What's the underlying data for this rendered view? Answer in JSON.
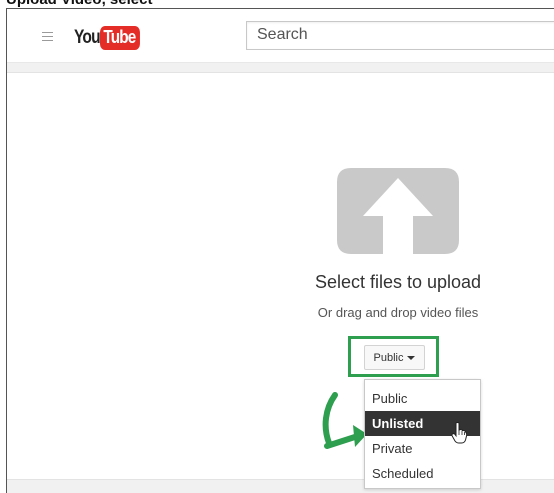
{
  "caption_fragment": "Upload Video, select",
  "header": {
    "logo_you": "You",
    "logo_tube": "Tube",
    "search_placeholder": "Search",
    "icons": [
      "menu-icon"
    ]
  },
  "upload": {
    "title": "Select files to upload",
    "subtitle": "Or drag and drop video files",
    "icon": "upload-arrow-icon"
  },
  "privacy": {
    "selected_label": "Public",
    "options": [
      "Public",
      "Unlisted",
      "Private",
      "Scheduled"
    ],
    "hovered_option": "Unlisted"
  },
  "annotation_colors": {
    "highlight": "#2e9e4f",
    "arrow": "#2e9e4f",
    "brand_red": "#e52d27"
  }
}
